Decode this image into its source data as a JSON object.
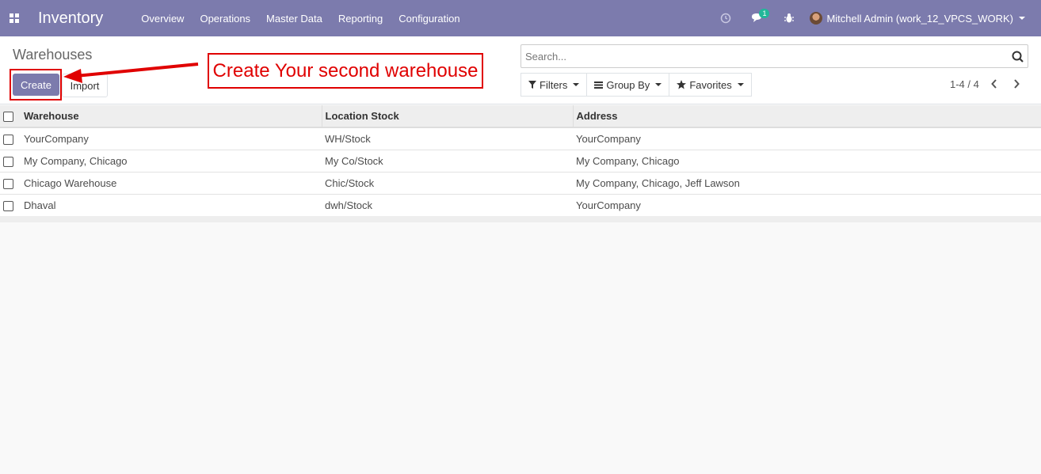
{
  "navbar": {
    "brand": "Inventory",
    "menu": [
      "Overview",
      "Operations",
      "Master Data",
      "Reporting",
      "Configuration"
    ],
    "message_badge": "1",
    "user": "Mitchell Admin (work_12_VPCS_WORK)"
  },
  "control_panel": {
    "breadcrumb": "Warehouses",
    "create_label": "Create",
    "import_label": "Import",
    "search_placeholder": "Search...",
    "filters_label": "Filters",
    "groupby_label": "Group By",
    "favorites_label": "Favorites",
    "pager": "1-4 / 4"
  },
  "annotation": {
    "text": "Create Your second warehouse",
    "color": "#e00000"
  },
  "table": {
    "headers": [
      "Warehouse",
      "Location Stock",
      "Address"
    ],
    "rows": [
      [
        "YourCompany",
        "WH/Stock",
        "YourCompany"
      ],
      [
        "My Company, Chicago",
        "My Co/Stock",
        "My Company, Chicago"
      ],
      [
        "Chicago Warehouse",
        "Chic/Stock",
        "My Company, Chicago, Jeff Lawson"
      ],
      [
        "Dhaval",
        "dwh/Stock",
        "YourCompany"
      ]
    ]
  },
  "colors": {
    "brand": "#7c7bad",
    "badge": "#21b799"
  }
}
